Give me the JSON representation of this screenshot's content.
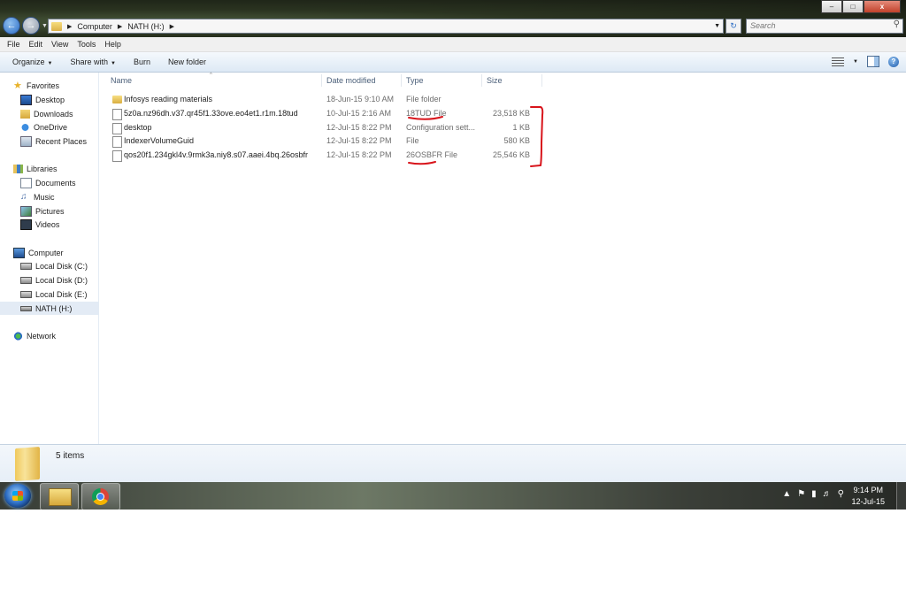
{
  "address": {
    "segments": [
      "Computer",
      "NATH (H:)"
    ]
  },
  "search": {
    "placeholder": "Search"
  },
  "window_controls": {
    "minimize": "–",
    "maximize": "□",
    "close": "x"
  },
  "menu": [
    "File",
    "Edit",
    "View",
    "Tools",
    "Help"
  ],
  "commands": {
    "organize": "Organize",
    "share_with": "Share with",
    "burn": "Burn",
    "new_folder": "New folder"
  },
  "nav": {
    "favorites": {
      "label": "Favorites",
      "items": [
        "Desktop",
        "Downloads",
        "OneDrive",
        "Recent Places"
      ]
    },
    "libraries": {
      "label": "Libraries",
      "items": [
        "Documents",
        "Music",
        "Pictures",
        "Videos"
      ]
    },
    "computer": {
      "label": "Computer",
      "items": [
        "Local Disk (C:)",
        "Local Disk (D:)",
        "Local Disk (E:)",
        "NATH (H:)"
      ]
    },
    "network": {
      "label": "Network"
    }
  },
  "columns": {
    "name": "Name",
    "date": "Date modified",
    "type": "Type",
    "size": "Size"
  },
  "files": [
    {
      "name": "Infosys reading materials",
      "date": "18-Jun-15 9:10 AM",
      "type": "File folder",
      "size": "",
      "icon": "folder-icon"
    },
    {
      "name": "5z0a.nz96dh.v37.qr45f1.33ove.eo4et1.r1m.18tud",
      "date": "10-Jul-15 2:16 AM",
      "type": "18TUD File",
      "size": "23,518 KB",
      "icon": "file-icon"
    },
    {
      "name": "desktop",
      "date": "12-Jul-15 8:22 PM",
      "type": "Configuration sett...",
      "size": "1 KB",
      "icon": "config-file-icon"
    },
    {
      "name": "IndexerVolumeGuid",
      "date": "12-Jul-15 8:22 PM",
      "type": "File",
      "size": "580 KB",
      "icon": "file-icon"
    },
    {
      "name": "qos20f1.234gkl4v.9rmk3a.niy8.s07.aaei.4bq.26osbfr",
      "date": "12-Jul-15 8:22 PM",
      "type": "26OSBFR File",
      "size": "25,546 KB",
      "icon": "file-icon"
    }
  ],
  "details": {
    "count": "5 items"
  },
  "taskbar": {
    "time": "9:14 PM",
    "date": "12-Jul-15"
  },
  "colors": {
    "annotation_red": "#d8141b",
    "nav_selected": "#e3ebf5",
    "column_header_text": "#4c607a"
  }
}
